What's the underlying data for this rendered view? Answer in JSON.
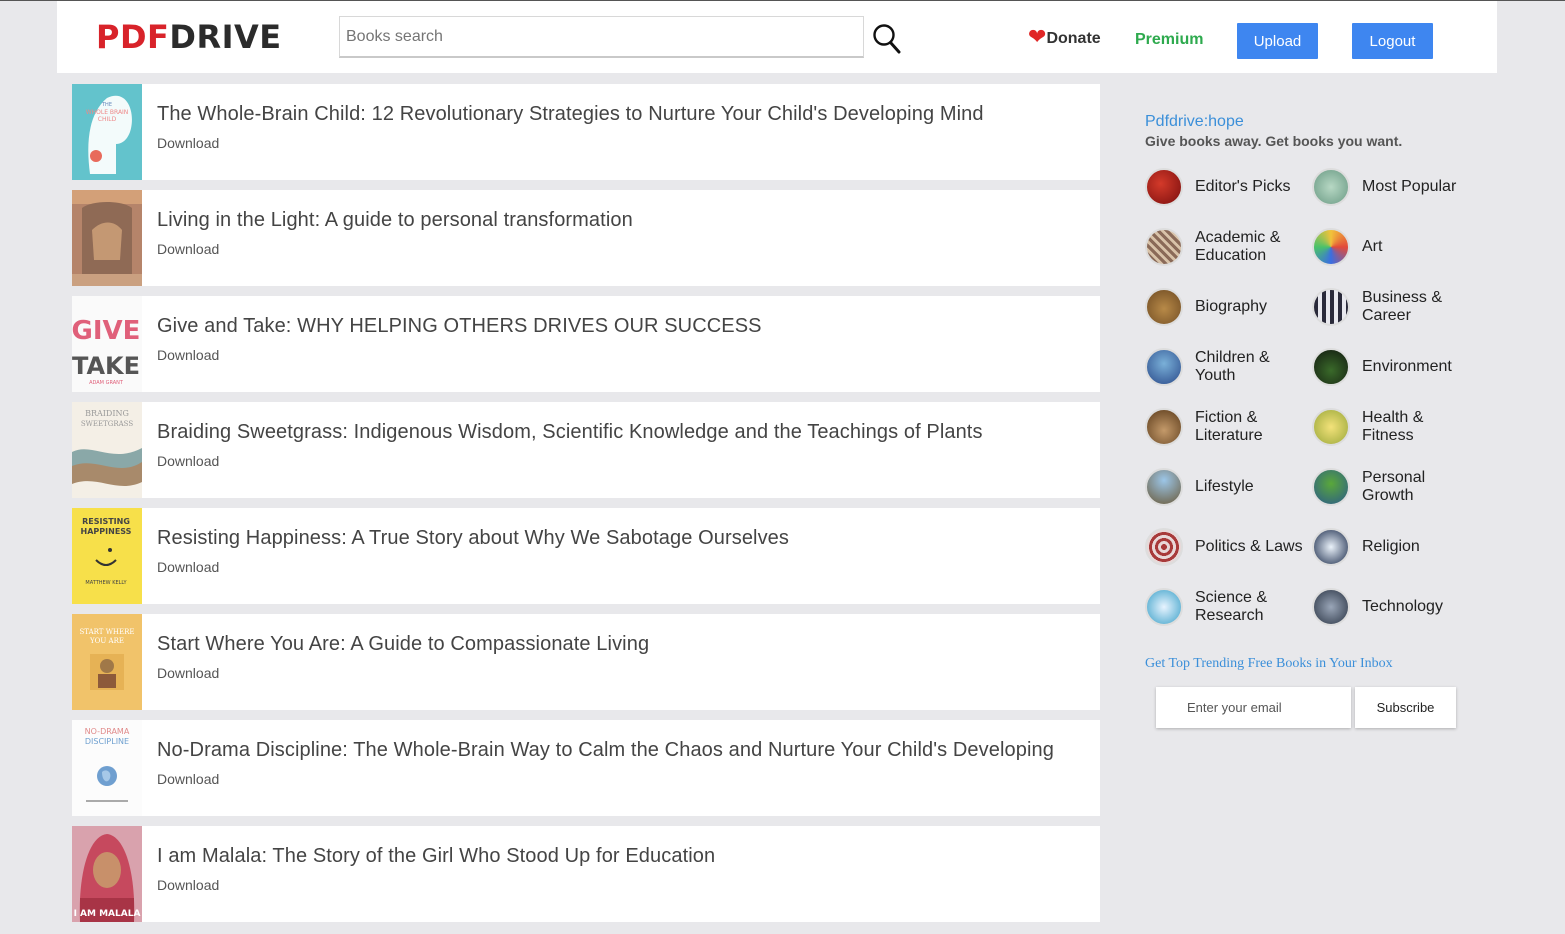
{
  "header": {
    "logo_pdf": "PDF",
    "logo_drive": "DRIVE",
    "search_placeholder": "Books search",
    "donate_label": "Donate",
    "premium_label": "Premium",
    "upload_label": "Upload",
    "logout_label": "Logout"
  },
  "books": [
    {
      "title": "The Whole-Brain Child: 12 Revolutionary Strategies to Nurture Your Child's Developing Mind",
      "download": "Download"
    },
    {
      "title": "Living in the Light: A guide to personal transformation",
      "download": "Download"
    },
    {
      "title": "Give and Take: WHY HELPING OTHERS DRIVES OUR SUCCESS",
      "download": "Download"
    },
    {
      "title": "Braiding Sweetgrass: Indigenous Wisdom, Scientific Knowledge and the Teachings of Plants",
      "download": "Download"
    },
    {
      "title": "Resisting Happiness: A True Story about Why We Sabotage Ourselves",
      "download": "Download"
    },
    {
      "title": "Start Where You Are: A Guide to Compassionate Living",
      "download": "Download"
    },
    {
      "title": "No-Drama Discipline: The Whole-Brain Way to Calm the Chaos and Nurture Your Child's Developing",
      "download": "Download"
    },
    {
      "title": "I am Malala: The Story of the Girl Who Stood Up for Education",
      "download": "Download"
    }
  ],
  "sidebar": {
    "hope_link": "Pdfdrive:hope",
    "hope_sub": "Give books away. Get books you want.",
    "categories": [
      {
        "label": "Editor's Picks",
        "icon": "editors-picks-icon"
      },
      {
        "label": "Most Popular",
        "icon": "most-popular-icon"
      },
      {
        "label": "Academic & Education",
        "icon": "academic-icon"
      },
      {
        "label": "Art",
        "icon": "art-icon"
      },
      {
        "label": "Biography",
        "icon": "biography-icon"
      },
      {
        "label": "Business & Career",
        "icon": "business-icon"
      },
      {
        "label": "Children & Youth",
        "icon": "children-icon"
      },
      {
        "label": "Environment",
        "icon": "environment-icon"
      },
      {
        "label": "Fiction & Literature",
        "icon": "fiction-icon"
      },
      {
        "label": "Health & Fitness",
        "icon": "health-icon"
      },
      {
        "label": "Lifestyle",
        "icon": "lifestyle-icon"
      },
      {
        "label": "Personal Growth",
        "icon": "personal-growth-icon"
      },
      {
        "label": "Politics & Laws",
        "icon": "politics-icon"
      },
      {
        "label": "Religion",
        "icon": "religion-icon"
      },
      {
        "label": "Science & Research",
        "icon": "science-icon"
      },
      {
        "label": "Technology",
        "icon": "technology-icon"
      }
    ],
    "trend_text": "Get Top Trending Free Books in Your Inbox",
    "email_placeholder": "Enter your email",
    "subscribe_label": "Subscribe"
  },
  "colors": {
    "brand_red": "#d8232a",
    "button_blue": "#3e86f0",
    "premium_green": "#2eaa4e",
    "link_blue": "#3b8fd9"
  }
}
